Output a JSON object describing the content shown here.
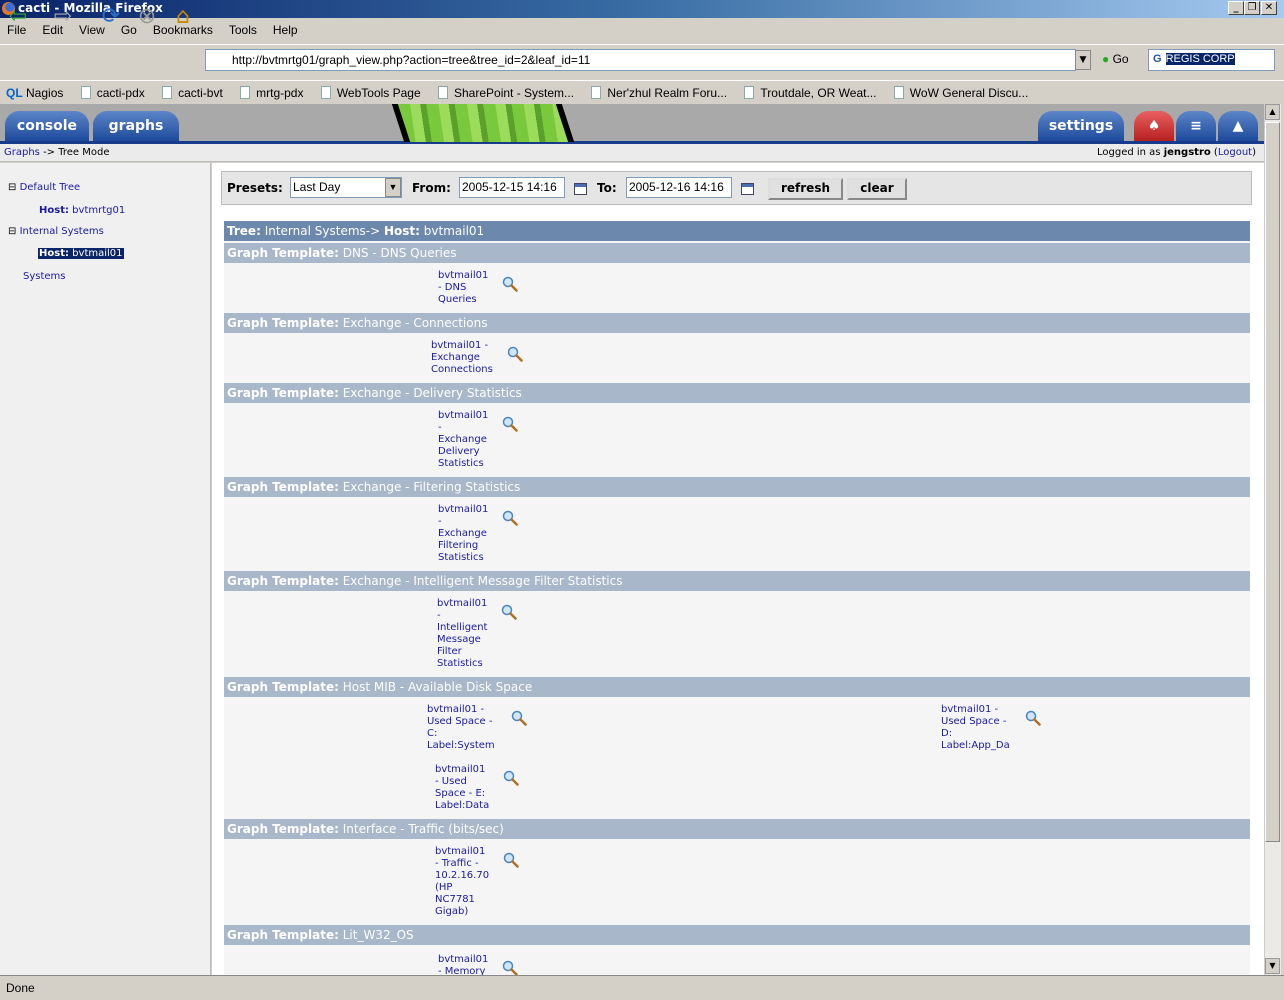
{
  "window": {
    "title": "cacti - Mozilla Firefox"
  },
  "menu": [
    "File",
    "Edit",
    "View",
    "Go",
    "Bookmarks",
    "Tools",
    "Help"
  ],
  "nav": {
    "url": "http://bvtmrtg01/graph_view.php?action=tree&tree_id=2&leaf_id=11",
    "go_label": "Go",
    "search_value": "REGIS CORP"
  },
  "bookmarks": [
    "Nagios",
    "cacti-pdx",
    "cacti-bvt",
    "mrtg-pdx",
    "WebTools Page",
    "SharePoint - System...",
    "Ner'zhul Realm Foru...",
    "Troutdale, OR Weat...",
    "WoW General Discu..."
  ],
  "tabs": {
    "console": "console",
    "graphs": "graphs",
    "settings": "settings"
  },
  "breadcrumb": {
    "link": "Graphs",
    "rest": "-> Tree Mode"
  },
  "login": {
    "prefix": "Logged in as",
    "user": "jengstro",
    "logout": "Logout"
  },
  "tree": {
    "default_tree": "Default Tree",
    "host_label": "Host:",
    "host1": "bvtmrtg01",
    "internal": "Internal Systems",
    "host2": "bvtmail01",
    "systems": "Systems"
  },
  "filter": {
    "presets_label": "Presets:",
    "preset": "Last Day",
    "from_label": "From:",
    "from": "2005-12-15 14:16",
    "to_label": "To:",
    "to": "2005-12-16 14:16",
    "refresh": "refresh",
    "clear": "clear"
  },
  "content": {
    "tree_label": "Tree:",
    "tree_value": "Internal Systems->",
    "host_label": "Host:",
    "host_value": "bvtmail01",
    "template_label": "Graph Template:",
    "sections": [
      {
        "title": "DNS - DNS Queries",
        "graphs": [
          "bvtmail01\n- DNS\nQueries"
        ]
      },
      {
        "title": "Exchange - Connections",
        "graphs": [
          "bvtmail01 -\nExchange\nConnections"
        ]
      },
      {
        "title": "Exchange - Delivery Statistics",
        "graphs": [
          "bvtmail01\n-\nExchange\nDelivery\nStatistics"
        ]
      },
      {
        "title": "Exchange - Filtering Statistics",
        "graphs": [
          "bvtmail01\n-\nExchange\nFiltering\nStatistics"
        ]
      },
      {
        "title": "Exchange - Intelligent Message Filter Statistics",
        "graphs": [
          "bvtmail01\n-\nIntelligent\nMessage\nFilter\nStatistics"
        ]
      },
      {
        "title": "Host MIB - Available Disk Space",
        "graphs": [
          "bvtmail01 -\nUsed Space -\nC:\nLabel:System",
          "bvtmail01 -\nUsed Space -\nD:\nLabel:App_Da",
          "bvtmail01\n- Used\nSpace - E:\nLabel:Data"
        ]
      },
      {
        "title": "Interface - Traffic (bits/sec)",
        "graphs": [
          "bvtmail01\n- Traffic -\n10.2.16.70\n(HP\nNC7781\nGigab)"
        ]
      },
      {
        "title": "Lit_W32_OS",
        "graphs": [
          "bvtmail01\n- Memory"
        ]
      }
    ]
  },
  "status": "Done",
  "colors": {
    "header_dark": "#6d88ad",
    "header_light": "#a9b7cb",
    "link": "#1a1aa6",
    "tab": "#1d4a9c"
  }
}
